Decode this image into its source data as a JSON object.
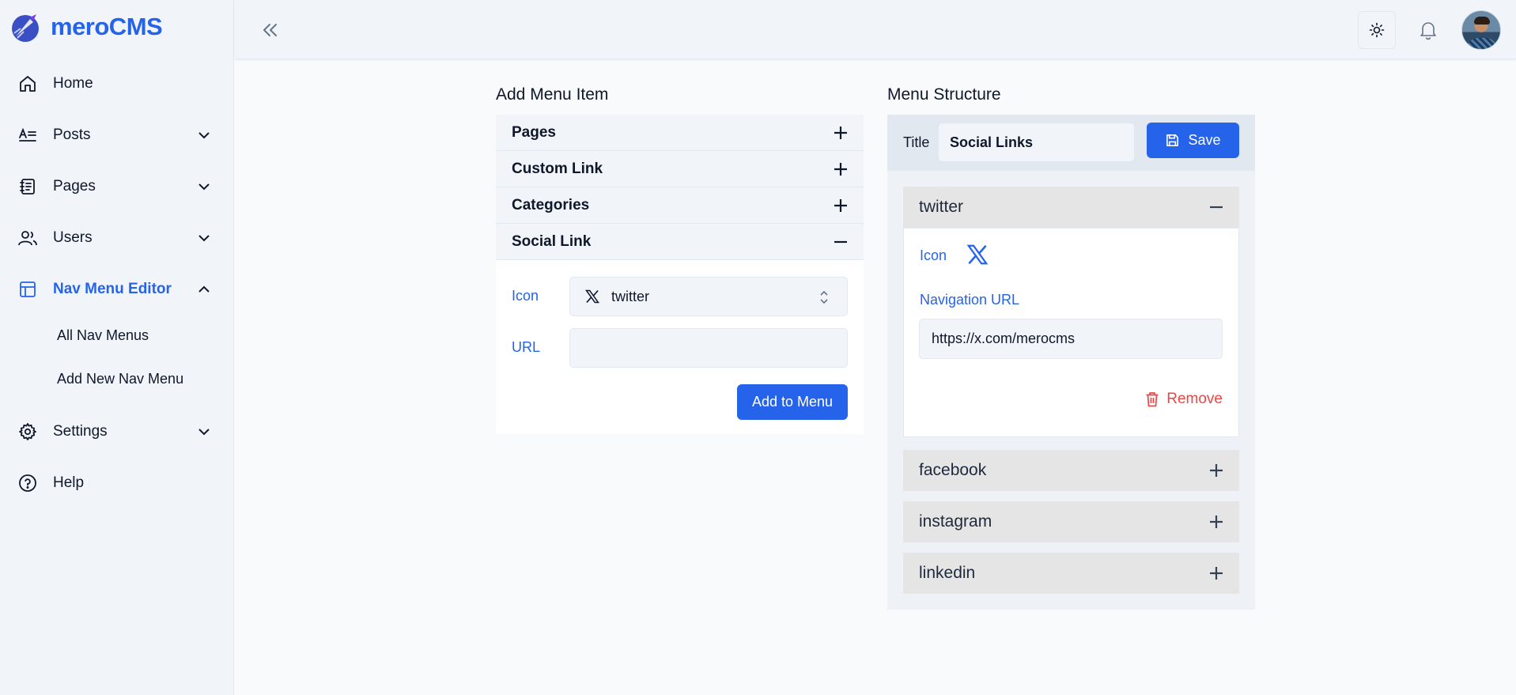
{
  "brand": {
    "name": "meroCMS"
  },
  "sidebar": {
    "items": [
      {
        "label": "Home",
        "icon": "home-icon"
      },
      {
        "label": "Posts",
        "icon": "posts-icon"
      },
      {
        "label": "Pages",
        "icon": "pages-icon"
      },
      {
        "label": "Users",
        "icon": "users-icon"
      },
      {
        "label": "Nav Menu Editor",
        "icon": "layout-icon",
        "active": true
      },
      {
        "label": "Settings",
        "icon": "gear-icon"
      },
      {
        "label": "Help",
        "icon": "help-icon"
      }
    ],
    "subitems": [
      {
        "label": "All Nav Menus"
      },
      {
        "label": "Add New Nav Menu"
      }
    ]
  },
  "add_menu": {
    "title": "Add Menu Item",
    "sections": [
      {
        "label": "Pages",
        "state": "collapsed"
      },
      {
        "label": "Custom Link",
        "state": "collapsed"
      },
      {
        "label": "Categories",
        "state": "collapsed"
      },
      {
        "label": "Social Link",
        "state": "expanded"
      }
    ],
    "icon_label": "Icon",
    "icon_value": "twitter",
    "url_label": "URL",
    "url_value": "",
    "add_button": "Add to Menu"
  },
  "menu_structure": {
    "title": "Menu Structure",
    "title_label": "Title",
    "title_value": "Social Links",
    "save_button": "Save",
    "items": [
      {
        "name": "twitter",
        "state": "expanded"
      },
      {
        "name": "facebook",
        "state": "collapsed"
      },
      {
        "name": "instagram",
        "state": "collapsed"
      },
      {
        "name": "linkedin",
        "state": "collapsed"
      }
    ],
    "open_item": {
      "icon_label": "Icon",
      "nav_url_label": "Navigation URL",
      "nav_url_value": "https://x.com/merocms",
      "remove_button": "Remove"
    }
  },
  "colors": {
    "accent": "#2563eb",
    "danger": "#ef4444",
    "sidebar_bg": "#f1f5f9"
  }
}
